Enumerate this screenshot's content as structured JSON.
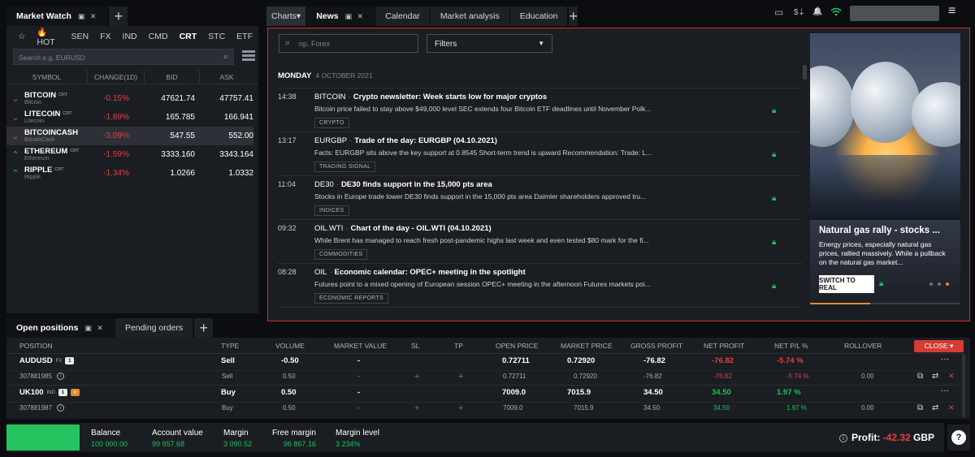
{
  "market_watch": {
    "tab_label": "Market Watch",
    "tab_controls": "▣ ✕",
    "plus": "+",
    "star": "☆",
    "categories": [
      {
        "label": "HOT"
      },
      {
        "label": "SEN"
      },
      {
        "label": "FX"
      },
      {
        "label": "IND"
      },
      {
        "label": "CMD"
      },
      {
        "label": "CRT"
      },
      {
        "label": "STC"
      },
      {
        "label": "ETF"
      }
    ],
    "selected_category": "CRT",
    "search_placeholder": "Search e.g. EURUSD",
    "columns": [
      "SYMBOL",
      "CHANGE(1D)",
      "BID",
      "ASK"
    ],
    "rows": [
      {
        "arrow": "⌄",
        "arrow_color": "#e3403e",
        "symbol": "BITCOIN",
        "tag": "CRT",
        "name": "Bitcoin",
        "change": "-0.15%",
        "bid": "47621.74",
        "ask": "47757.41"
      },
      {
        "arrow": "⌄",
        "arrow_color": "#e3403e",
        "symbol": "LITECOIN",
        "tag": "CRT",
        "name": "Litecoin",
        "change": "-1.89%",
        "bid": "165.785",
        "ask": "166.941"
      },
      {
        "arrow": "⌄",
        "arrow_color": "#e3403e",
        "symbol": "BITCOINCASH",
        "tag": "",
        "name": "BitcoinCash",
        "change": "-3.09%",
        "bid": "547.55",
        "ask": "552.00"
      },
      {
        "arrow": "⌃",
        "arrow_color": "#22c55e",
        "symbol": "ETHEREUM",
        "tag": "CRT",
        "name": "Ethereum",
        "change": "-1.59%",
        "bid": "3333.160",
        "ask": "3343.164"
      },
      {
        "arrow": "⌃",
        "arrow_color": "#22c55e",
        "symbol": "RIPPLE",
        "tag": "CRT",
        "name": "Ripple",
        "change": "-1.34%",
        "bid": "1.0266",
        "ask": "1.0332"
      }
    ]
  },
  "top_tabs": {
    "charts": "Charts▾",
    "news": "News",
    "news_controls": "▣ ✕",
    "calendar": "Calendar",
    "analysis": "Market analysis",
    "education": "Education",
    "plus": "+"
  },
  "news": {
    "search_placeholder": "np. Forex",
    "filters_label": "Filters",
    "day": "MONDAY",
    "date": "4 OCTOBER 2021",
    "items": [
      {
        "time": "14:38",
        "symbol": "BITCOIN",
        "title": "Crypto newsletter: Week starts low for major cryptos",
        "desc": "Bitcoin price failed to stay above $49,000 level SEC extends four Bitcoin ETF deadlines until November Polk...",
        "tag": "CRYPTO"
      },
      {
        "time": "13:17",
        "symbol": "EURGBP",
        "title": "Trade of the day: EURGBP (04.10.2021)",
        "desc": "Facts: EURGBP sits above the key support at 0.8545 Short-term trend is upward Recommendation: Trade: L...",
        "tag": "TRADING SIGNAL"
      },
      {
        "time": "11:04",
        "symbol": "DE30",
        "title": "DE30 finds support in the 15,000 pts area",
        "desc": "Stocks in Europe trade lower DE30 finds support in the 15,000 pts area Daimler shareholders approved tru...",
        "tag": "INDICES"
      },
      {
        "time": "09:32",
        "symbol": "OIL.WTI",
        "title": "Chart of the day - OIL.WTI (04.10.2021)",
        "desc": "While Brent has managed to reach fresh post-pandemic highs last week and even tested $80 mark for the fi...",
        "tag": "COMMODITIES"
      },
      {
        "time": "08:28",
        "symbol": "OIL",
        "title": "Economic calendar: OPEC+ meeting in the spotlight",
        "desc": "Futures point to a mixed opening of European session OPEC+ meeting in the afternoon Futures markets poi...",
        "tag": "ECONOMIC REPORTS"
      }
    ],
    "promo": {
      "title": "Natural gas rally - stocks ...",
      "text": "Energy prices, especially natural gas prices, rallied massively. While a pullback on the natural gas market...",
      "button": "SWITCH TO REAL"
    }
  },
  "positions": {
    "tab_open": "Open positions",
    "tab_controls": "▣ ✕",
    "tab_pending": "Pending orders",
    "plus": "+",
    "close_label": "CLOSE ▾",
    "columns": [
      "POSITION",
      "TYPE",
      "VOLUME",
      "MARKET VALUE",
      "SL",
      "TP",
      "OPEN PRICE",
      "MARKET PRICE",
      "GROSS PROFIT",
      "NET PROFIT",
      "NET P/L %",
      "ROLLOVER"
    ],
    "groups": [
      {
        "symbol": "AUDUSD",
        "market": "FX",
        "count": "1",
        "extra_badge": "",
        "type": "Sell",
        "volume": "-0.50",
        "market_value": "-",
        "open_price": "0.72711",
        "market_price": "0.72920",
        "gross_profit": "-76.82",
        "net_profit": "-76.82",
        "net_pl": "-5.74 %",
        "sub": {
          "id": "307881985",
          "type": "Sell",
          "volume": "0.50",
          "market_value": "-",
          "sl": "+",
          "tp": "+",
          "open_price": "0.72711",
          "market_price": "0.72920",
          "gross_profit": "-76.82",
          "net_profit": "-76.82",
          "net_pl": "-5.74 %",
          "rollover": "0.00"
        }
      },
      {
        "symbol": "UK100",
        "market": "IND",
        "count": "1",
        "extra_badge": "≡",
        "type": "Buy",
        "volume": "0.50",
        "market_value": "-",
        "open_price": "7009.0",
        "market_price": "7015.9",
        "gross_profit": "34.50",
        "net_profit": "34.50",
        "net_pl": "1.97 %",
        "sub": {
          "id": "307881987",
          "type": "Buy",
          "volume": "0.50",
          "market_value": "-",
          "sl": "+",
          "tp": "+",
          "open_price": "7009.0",
          "market_price": "7015.9",
          "gross_profit": "34.50",
          "net_profit": "34.50",
          "net_pl": "1.97 %",
          "rollover": "0.00"
        }
      }
    ],
    "more": "···",
    "row_actions": {
      "copy": "⧉",
      "swap": "⇄",
      "remove": "✕"
    }
  },
  "account": {
    "balance_label": "Balance",
    "balance": "100 000.00",
    "value_label": "Account value",
    "value": "99 957.68",
    "margin_label": "Margin",
    "margin": "3 090.52",
    "free_label": "Free margin",
    "free": "96 867.16",
    "level_label": "Margin level",
    "level": "3 234%",
    "profit_label": "Profit:",
    "profit_value": "-42.32",
    "currency": "GBP",
    "help": "?"
  },
  "top_right": {
    "monitor": "▭",
    "dollar": "$⇣",
    "bell": "🔔",
    "wifi": "📶",
    "menu": "≡"
  }
}
